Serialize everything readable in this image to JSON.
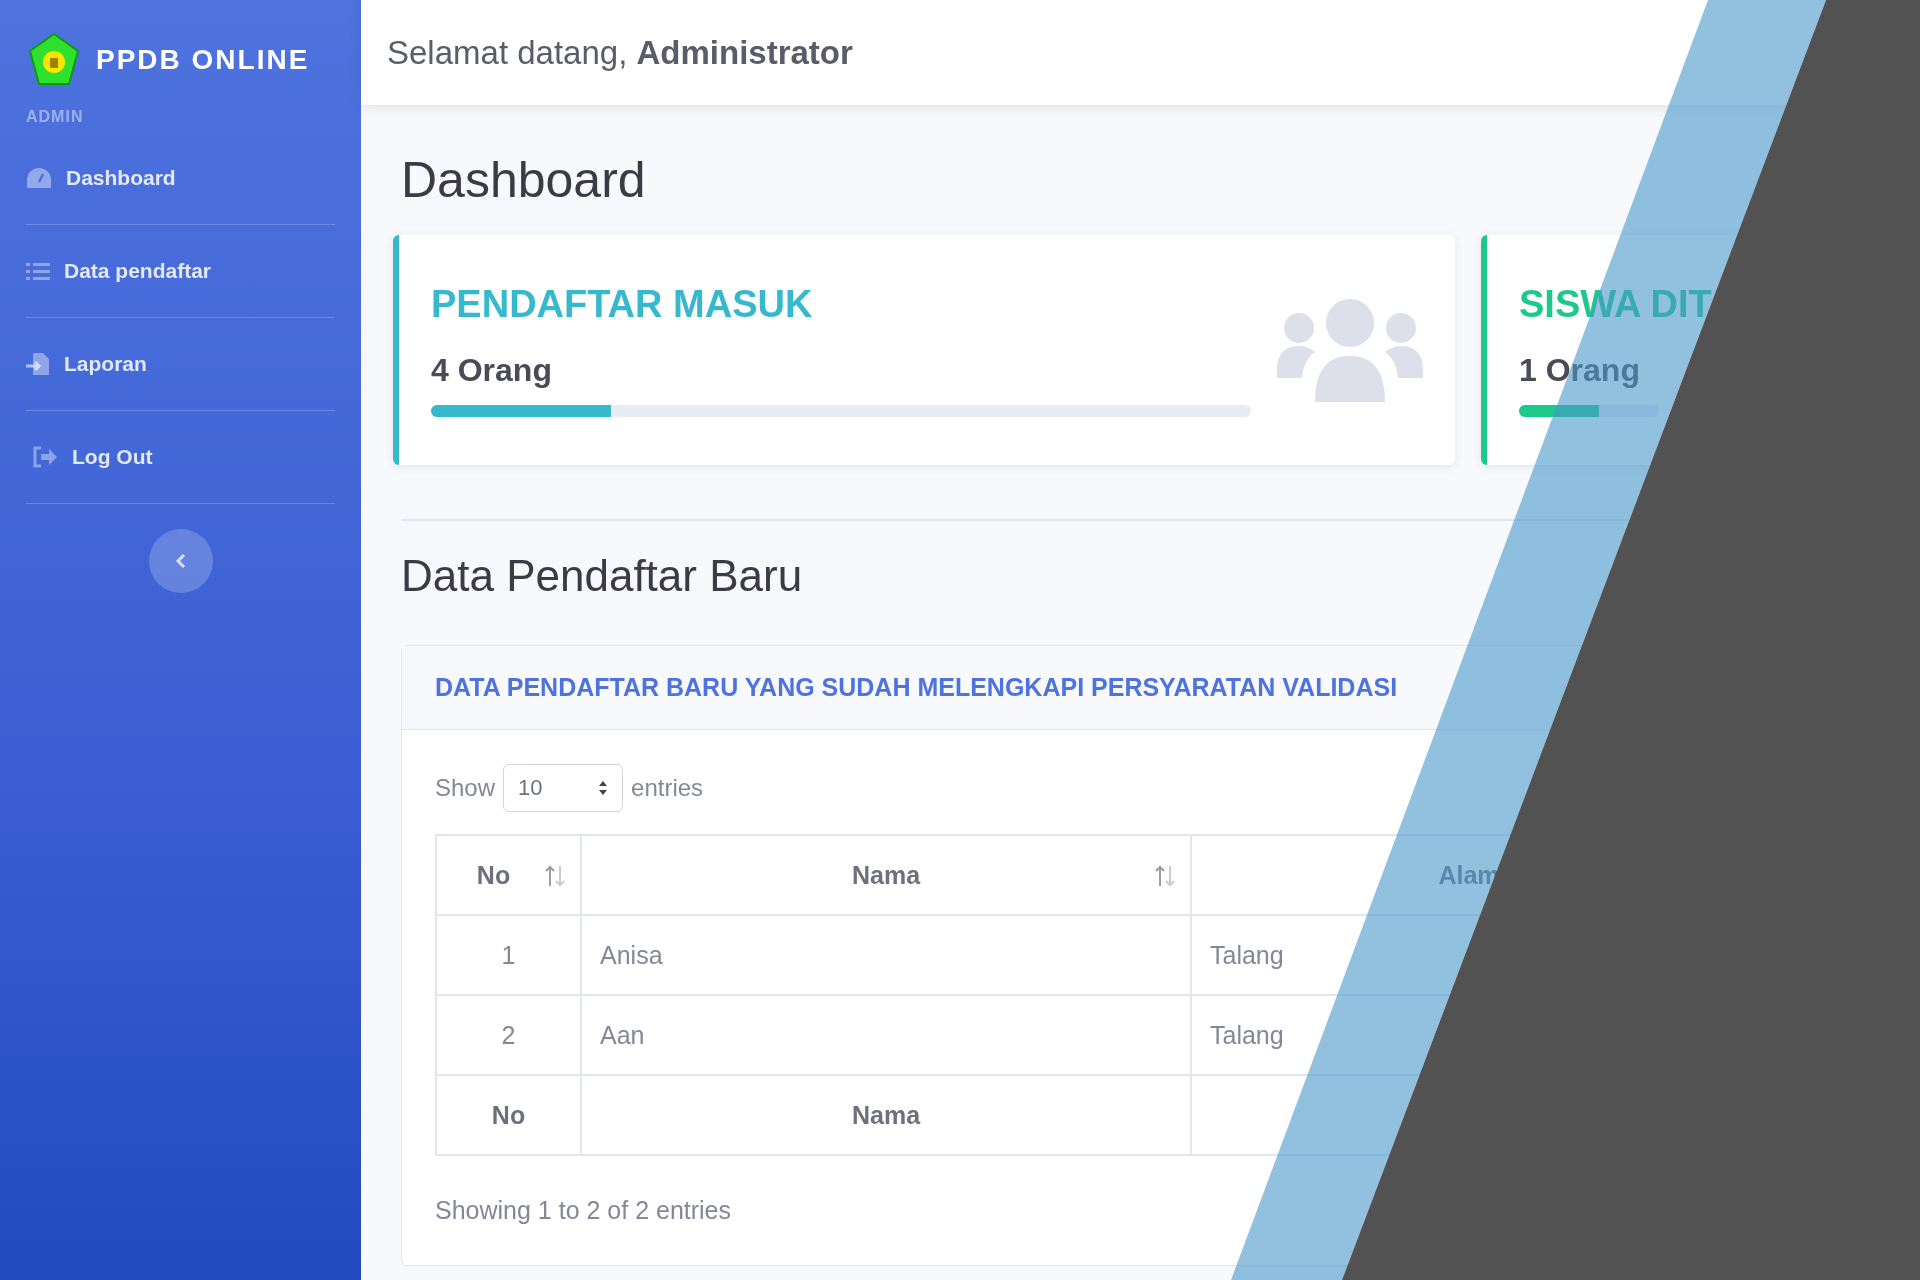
{
  "sidebar": {
    "brand": "PPDB ONLINE",
    "section": "ADMIN",
    "items": [
      {
        "label": "Dashboard"
      },
      {
        "label": "Data pendaftar"
      },
      {
        "label": "Laporan"
      },
      {
        "label": "Log Out"
      }
    ]
  },
  "header": {
    "greeting": "Selamat datang, **Administrator**"
  },
  "page_title": "Dashboard",
  "stat_cards": [
    {
      "title": "PENDAFTAR MASUK",
      "value": "4 Orang",
      "level": 0.22,
      "color": "#36b9cc"
    },
    {
      "title": "SISWA DIT",
      "value": "1 Orang",
      "level": 0.57,
      "color": "#1cc88a"
    }
  ],
  "section_title": "Data Pendaftar Baru",
  "table_card": {
    "title": "DATA PENDAFTAR BARU YANG SUDAH MELENGKAPI PERSYARATAN VALIDASI",
    "length": {
      "before": "Show",
      "value": "10",
      "after": "entries"
    },
    "columns": [
      {
        "label": "No",
        "sortable": true
      },
      {
        "label": "Nama",
        "sortable": true
      },
      {
        "label": "Alam"
      }
    ],
    "rows": [
      [
        "1",
        "Anisa",
        "Talang"
      ],
      [
        "2",
        "Aan",
        "Talang"
      ]
    ],
    "footer": [
      "No",
      "Nama"
    ],
    "info": "Showing 1 to 2 of 2 entries"
  }
}
